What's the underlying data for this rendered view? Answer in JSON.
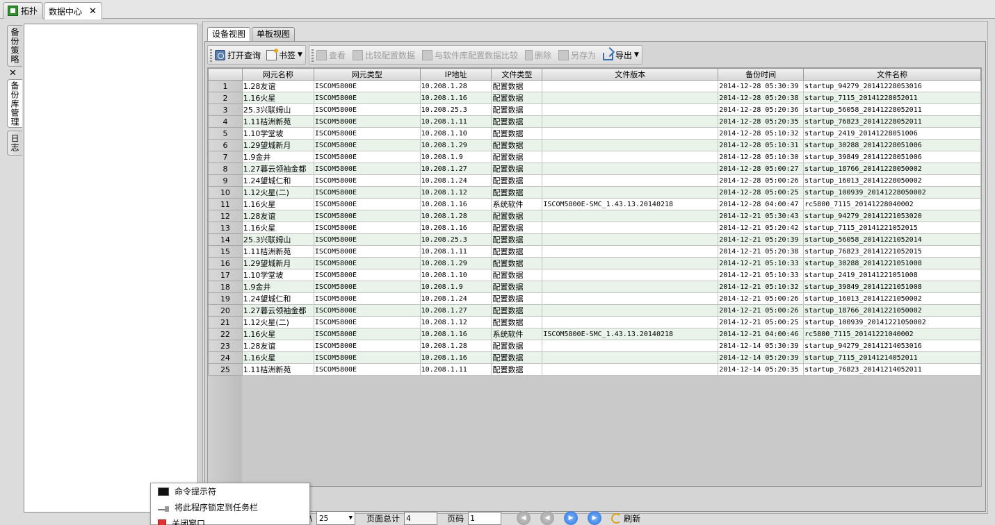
{
  "top_tabs": [
    {
      "label": "拓扑",
      "active": false
    },
    {
      "label": "数据中心",
      "active": true
    }
  ],
  "side_tabs": [
    {
      "label": "备份策略"
    },
    {
      "label": "备份库管理"
    },
    {
      "label": "日志"
    }
  ],
  "sub_tabs": [
    {
      "label": "设备视图",
      "active": true
    },
    {
      "label": "单板视图",
      "active": false
    }
  ],
  "toolbar": {
    "open_query": "打开查询",
    "bookmark": "书签",
    "view": "查看",
    "compare_config": "比较配置数据",
    "compare_lib": "与软件库配置数据比较",
    "delete": "删除",
    "save_as": "另存为",
    "export": "导出"
  },
  "table": {
    "headers": [
      "网元名称",
      "网元类型",
      "IP地址",
      "文件类型",
      "文件版本",
      "备份时间",
      "文件名称"
    ],
    "rows": [
      [
        "1",
        "1.28友谊",
        "ISCOM5800E",
        "10.208.1.28",
        "配置数据",
        "",
        "2014-12-28 05:30:39",
        "startup_94279_20141228053016"
      ],
      [
        "2",
        "1.16火星",
        "ISCOM5800E",
        "10.208.1.16",
        "配置数据",
        "",
        "2014-12-28 05:20:38",
        "startup_7115_20141228052011"
      ],
      [
        "3",
        "25.3兴联姆山",
        "ISCOM5800E",
        "10.208.25.3",
        "配置数据",
        "",
        "2014-12-28 05:20:36",
        "startup_56058_20141228052011"
      ],
      [
        "4",
        "1.11桔洲新苑",
        "ISCOM5800E",
        "10.208.1.11",
        "配置数据",
        "",
        "2014-12-28 05:20:35",
        "startup_76823_20141228052011"
      ],
      [
        "5",
        "1.10学堂坡",
        "ISCOM5800E",
        "10.208.1.10",
        "配置数据",
        "",
        "2014-12-28 05:10:32",
        "startup_2419_20141228051006"
      ],
      [
        "6",
        "1.29望城新月",
        "ISCOM5800E",
        "10.208.1.29",
        "配置数据",
        "",
        "2014-12-28 05:10:31",
        "startup_30288_20141228051006"
      ],
      [
        "7",
        "1.9金井",
        "ISCOM5800E",
        "10.208.1.9",
        "配置数据",
        "",
        "2014-12-28 05:10:30",
        "startup_39849_20141228051006"
      ],
      [
        "8",
        "1.27暮云领袖金都",
        "ISCOM5800E",
        "10.208.1.27",
        "配置数据",
        "",
        "2014-12-28 05:00:27",
        "startup_18766_20141228050002"
      ],
      [
        "9",
        "1.24望城仁和",
        "ISCOM5800E",
        "10.208.1.24",
        "配置数据",
        "",
        "2014-12-28 05:00:26",
        "startup_16013_20141228050002"
      ],
      [
        "10",
        "1.12火星(二)",
        "ISCOM5800E",
        "10.208.1.12",
        "配置数据",
        "",
        "2014-12-28 05:00:25",
        "startup_100939_20141228050002"
      ],
      [
        "11",
        "1.16火星",
        "ISCOM5800E",
        "10.208.1.16",
        "系统软件",
        "ISCOM5800E-SMC_1.43.13.20140218",
        "2014-12-28 04:00:47",
        "rc5800_7115_20141228040002"
      ],
      [
        "12",
        "1.28友谊",
        "ISCOM5800E",
        "10.208.1.28",
        "配置数据",
        "",
        "2014-12-21 05:30:43",
        "startup_94279_20141221053020"
      ],
      [
        "13",
        "1.16火星",
        "ISCOM5800E",
        "10.208.1.16",
        "配置数据",
        "",
        "2014-12-21 05:20:42",
        "startup_7115_20141221052015"
      ],
      [
        "14",
        "25.3兴联姆山",
        "ISCOM5800E",
        "10.208.25.3",
        "配置数据",
        "",
        "2014-12-21 05:20:39",
        "startup_56058_20141221052014"
      ],
      [
        "15",
        "1.11桔洲新苑",
        "ISCOM5800E",
        "10.208.1.11",
        "配置数据",
        "",
        "2014-12-21 05:20:38",
        "startup_76823_20141221052015"
      ],
      [
        "16",
        "1.29望城新月",
        "ISCOM5800E",
        "10.208.1.29",
        "配置数据",
        "",
        "2014-12-21 05:10:33",
        "startup_30288_20141221051008"
      ],
      [
        "17",
        "1.10学堂坡",
        "ISCOM5800E",
        "10.208.1.10",
        "配置数据",
        "",
        "2014-12-21 05:10:33",
        "startup_2419_20141221051008"
      ],
      [
        "18",
        "1.9金井",
        "ISCOM5800E",
        "10.208.1.9",
        "配置数据",
        "",
        "2014-12-21 05:10:32",
        "startup_39849_20141221051008"
      ],
      [
        "19",
        "1.24望城仁和",
        "ISCOM5800E",
        "10.208.1.24",
        "配置数据",
        "",
        "2014-12-21 05:00:26",
        "startup_16013_20141221050002"
      ],
      [
        "20",
        "1.27暮云领袖金都",
        "ISCOM5800E",
        "10.208.1.27",
        "配置数据",
        "",
        "2014-12-21 05:00:26",
        "startup_18766_20141221050002"
      ],
      [
        "21",
        "1.12火星(二)",
        "ISCOM5800E",
        "10.208.1.12",
        "配置数据",
        "",
        "2014-12-21 05:00:25",
        "startup_100939_20141221050002"
      ],
      [
        "22",
        "1.16火星",
        "ISCOM5800E",
        "10.208.1.16",
        "系统软件",
        "ISCOM5800E-SMC_1.43.13.20140218",
        "2014-12-21 04:00:46",
        "rc5800_7115_20141221040002"
      ],
      [
        "23",
        "1.28友谊",
        "ISCOM5800E",
        "10.208.1.28",
        "配置数据",
        "",
        "2014-12-14 05:30:39",
        "startup_94279_20141214053016"
      ],
      [
        "24",
        "1.16火星",
        "ISCOM5800E",
        "10.208.1.16",
        "配置数据",
        "",
        "2014-12-14 05:20:39",
        "startup_7115_20141214052011"
      ],
      [
        "25",
        "1.11桔洲新苑",
        "ISCOM5800E",
        "10.208.1.11",
        "配置数据",
        "",
        "2014-12-14 05:20:35",
        "startup_76823_20141214052011"
      ]
    ]
  },
  "pager": {
    "page_size_prefix": "\\",
    "page_size": "25",
    "total_label": "页面总计",
    "total_value": "4",
    "page_label": "页码",
    "page_value": "1",
    "refresh": "刷新"
  },
  "popup": {
    "items": [
      "命令提示符",
      "将此程序锁定到任务栏",
      "关闭窗口"
    ]
  },
  "colors": {
    "alt_row": "#e9f3e9",
    "nav_active": "#2a6fd6"
  }
}
